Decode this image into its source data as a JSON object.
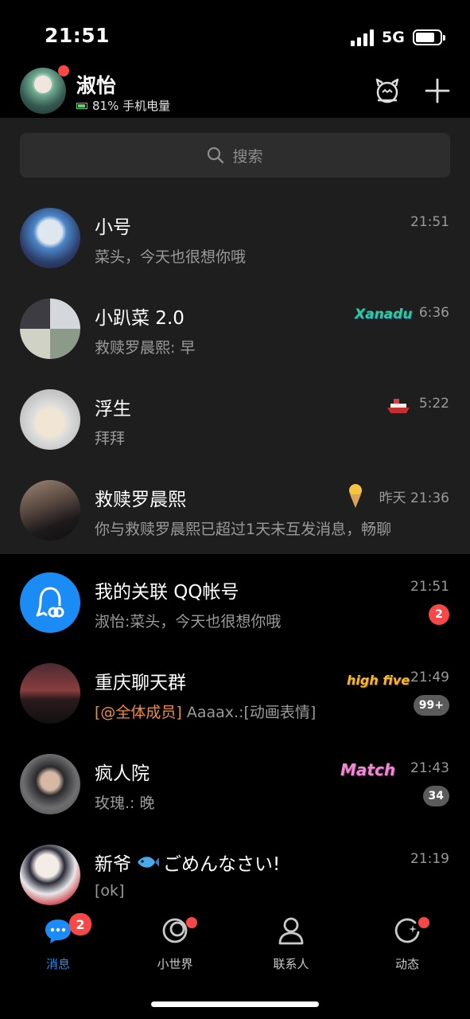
{
  "status": {
    "time": "21:51",
    "network": "5G"
  },
  "profile": {
    "name": "淑怡",
    "battery_text": "81% 手机电量"
  },
  "search": {
    "placeholder": "搜索"
  },
  "chats": [
    {
      "title": "小号",
      "preview": "菜头，今天也很想你哦",
      "time": "21:51"
    },
    {
      "title": "小趴菜 2.0",
      "preview": "救赎罗晨熙: 早",
      "time": "6:36",
      "tag": "Xanadu"
    },
    {
      "title": "浮生",
      "preview": "拜拜",
      "time": "5:22"
    },
    {
      "title": "救赎罗晨熙",
      "preview": "你与救赎罗晨熙已超过1天未互发消息，畅聊",
      "time": "昨天 21:36"
    },
    {
      "title": "我的关联 QQ帐号",
      "preview": "淑怡:菜头，今天也很想你哦",
      "time": "21:51",
      "badge": "2"
    },
    {
      "title": "重庆聊天群",
      "mention": "[@全体成员]",
      "preview": " Aaaax.:[动画表情]",
      "time": "21:49",
      "badge": "99+",
      "tag": "high five"
    },
    {
      "title": "疯人院",
      "preview": "玫瑰.: 晚",
      "time": "21:43",
      "badge": "34",
      "tag": "Match"
    },
    {
      "title_part1": "新爷",
      "title_part2": "ごめんなさい!",
      "preview": "[ok]",
      "time": "21:19"
    }
  ],
  "tabs": [
    {
      "label": "消息",
      "badge": "2",
      "icon": "message-bubble-icon"
    },
    {
      "label": "小世界",
      "icon": "planet-icon"
    },
    {
      "label": "联系人",
      "icon": "contact-person-icon"
    },
    {
      "label": "动态",
      "icon": "star-orbit-icon"
    }
  ],
  "colors": {
    "accent": "#1b8cf5",
    "badge_red": "#f74848",
    "mention": "#f08c3c"
  }
}
